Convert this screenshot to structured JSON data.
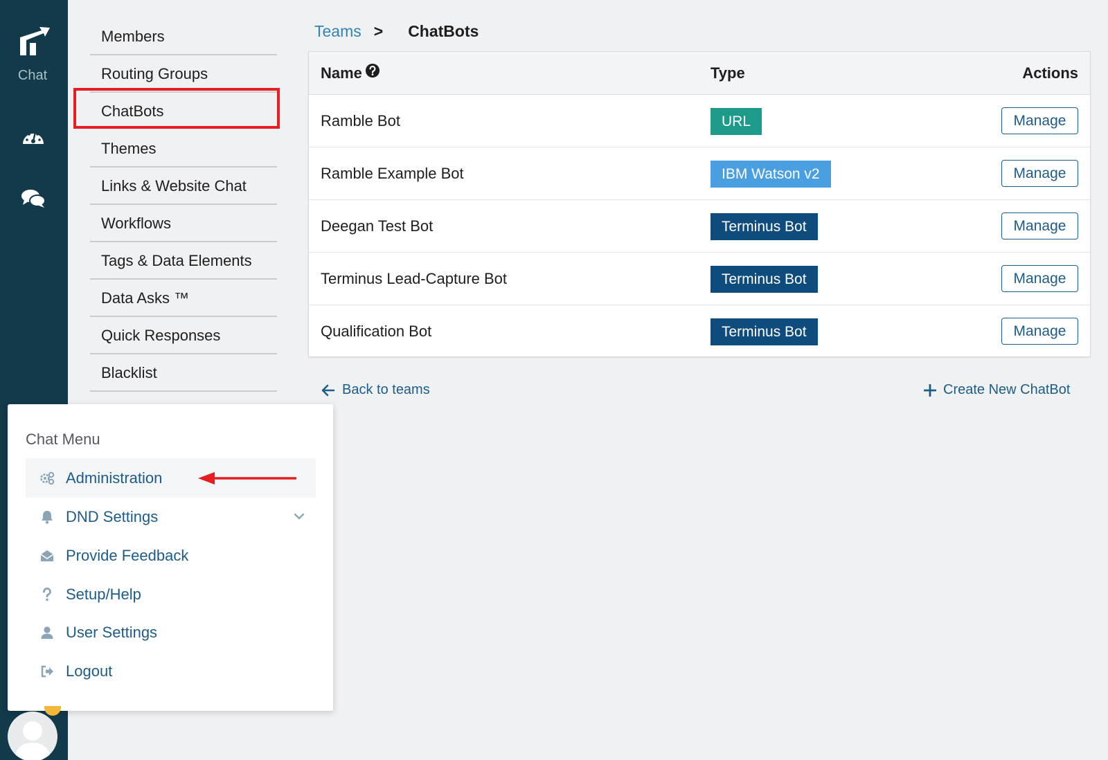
{
  "app": {
    "rail_label": "Chat"
  },
  "subnav": {
    "items": [
      {
        "label": "Members",
        "active": false
      },
      {
        "label": "Routing Groups",
        "active": false
      },
      {
        "label": "ChatBots",
        "active": true
      },
      {
        "label": "Themes",
        "active": false
      },
      {
        "label": "Links & Website Chat",
        "active": false
      },
      {
        "label": "Workflows",
        "active": false
      },
      {
        "label": "Tags & Data Elements",
        "active": false
      },
      {
        "label": "Data Asks ™",
        "active": false
      },
      {
        "label": "Quick Responses",
        "active": false
      },
      {
        "label": "Blacklist",
        "active": false
      }
    ]
  },
  "breadcrumb": {
    "parent": "Teams",
    "separator": ">",
    "current": "ChatBots"
  },
  "table": {
    "headers": {
      "name": "Name",
      "type": "Type",
      "actions": "Actions"
    },
    "rows": [
      {
        "name": "Ramble Bot",
        "type": "URL",
        "type_color": "#1e9a8a",
        "action": "Manage"
      },
      {
        "name": "Ramble Example Bot",
        "type": "IBM Watson v2",
        "type_color": "#4a9fe0",
        "action": "Manage"
      },
      {
        "name": "Deegan Test Bot",
        "type": "Terminus Bot",
        "type_color": "#0f4c7e",
        "action": "Manage"
      },
      {
        "name": "Terminus Lead-Capture Bot",
        "type": "Terminus Bot",
        "type_color": "#0f4c7e",
        "action": "Manage"
      },
      {
        "name": "Qualification Bot",
        "type": "Terminus Bot",
        "type_color": "#0f4c7e",
        "action": "Manage"
      }
    ]
  },
  "footer": {
    "back_label": "Back to teams",
    "create_label": "Create New ChatBot"
  },
  "chat_menu": {
    "title": "Chat Menu",
    "items": [
      {
        "label": "Administration",
        "icon": "gears-icon"
      },
      {
        "label": "DND Settings",
        "icon": "bell-icon"
      },
      {
        "label": "Provide Feedback",
        "icon": "envelope-open-icon"
      },
      {
        "label": "Setup/Help",
        "icon": "question-icon"
      },
      {
        "label": "User Settings",
        "icon": "user-icon"
      },
      {
        "label": "Logout",
        "icon": "logout-icon"
      }
    ]
  },
  "colors": {
    "rail": "#123a4b",
    "link": "#3582b0",
    "primary": "#1d5c86",
    "highlight": "#e61e22",
    "badge_url": "#1e9a8a",
    "badge_watson": "#4a9fe0",
    "badge_terminus": "#0f4c7e",
    "notification": "#f2b83a"
  }
}
